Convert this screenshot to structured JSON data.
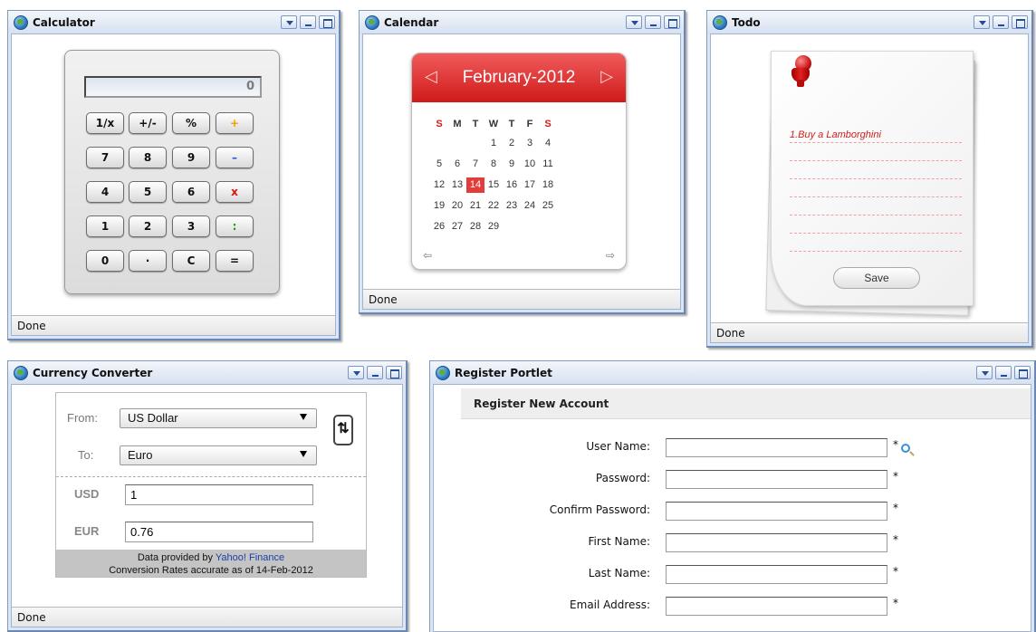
{
  "calculator": {
    "title": "Calculator",
    "status": "Done",
    "display": "0",
    "keys": [
      [
        "1/x",
        "+/-",
        "%",
        "+"
      ],
      [
        "7",
        "8",
        "9",
        "–"
      ],
      [
        "4",
        "5",
        "6",
        "x"
      ],
      [
        "1",
        "2",
        "3",
        ":"
      ],
      [
        "0",
        "·",
        "C",
        "="
      ]
    ],
    "op_colors": {
      "plus": "#f0a000",
      "minus": "#2a4fd0",
      "times": "#e01010",
      "divide": "#20a020"
    }
  },
  "calendar": {
    "title": "Calendar",
    "status": "Done",
    "month_label": "February-2012",
    "weekdays": [
      "S",
      "M",
      "T",
      "W",
      "T",
      "F",
      "S"
    ],
    "weeks": [
      [
        "",
        "",
        "",
        "1",
        "2",
        "3",
        "4"
      ],
      [
        "5",
        "6",
        "7",
        "8",
        "9",
        "10",
        "11"
      ],
      [
        "12",
        "13",
        "14",
        "15",
        "16",
        "17",
        "18"
      ],
      [
        "19",
        "20",
        "21",
        "22",
        "23",
        "24",
        "25"
      ],
      [
        "26",
        "27",
        "28",
        "29",
        "",
        "",
        ""
      ]
    ],
    "selected_day": "14",
    "prev_icon": "◁",
    "next_icon": "▷",
    "prev_year_icon": "⇦",
    "next_year_icon": "⇨",
    "accent": "#d9261f"
  },
  "todo": {
    "title": "Todo",
    "status": "Done",
    "items": [
      "1.Buy a Lamborghini"
    ],
    "save_label": "Save"
  },
  "currency": {
    "title": "Currency Converter",
    "status": "Done",
    "from_label": "From:",
    "from_value": "US Dollar",
    "to_label": "To:",
    "to_value": "Euro",
    "amount_code": "USD",
    "amount_value": "1",
    "result_code": "EUR",
    "result_value": "0.76",
    "footer_prefix": "Data provided by",
    "footer_link": "Yahoo! Finance",
    "footer_note": "Conversion Rates accurate as of 14-Feb-2012"
  },
  "register": {
    "title": "Register Portlet",
    "header": "Register New Account",
    "fields": [
      {
        "label": "User Name:",
        "required": "*"
      },
      {
        "label": "Password:",
        "required": "*"
      },
      {
        "label": "Confirm Password:",
        "required": "*"
      },
      {
        "label": "First Name:",
        "required": "*"
      },
      {
        "label": "Last Name:",
        "required": "*"
      },
      {
        "label": "Email Address:",
        "required": "*"
      }
    ]
  }
}
